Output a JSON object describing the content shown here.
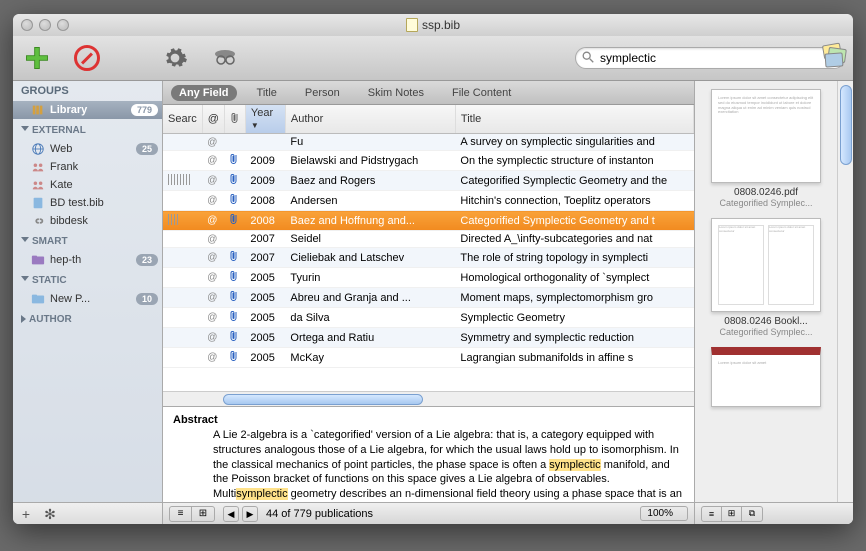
{
  "window": {
    "title": "ssp.bib"
  },
  "search": {
    "query": "symplectic"
  },
  "scopes": [
    "Any Field",
    "Title",
    "Person",
    "Skim Notes",
    "File Content"
  ],
  "active_scope": 0,
  "sidebar": {
    "groups_label": "GROUPS",
    "library": {
      "label": "Library",
      "count": "779"
    },
    "external_label": "EXTERNAL",
    "external": [
      {
        "label": "Web",
        "count": "25"
      },
      {
        "label": "Frank",
        "count": ""
      },
      {
        "label": "Kate",
        "count": ""
      },
      {
        "label": "BD test.bib",
        "count": ""
      },
      {
        "label": "bibdesk",
        "count": ""
      }
    ],
    "smart_label": "SMART",
    "smart": [
      {
        "label": "hep-th",
        "count": "23"
      }
    ],
    "static_label": "STATIC",
    "static": [
      {
        "label": "New P...",
        "count": "10"
      }
    ],
    "author_label": "AUTHOR"
  },
  "columns": {
    "search": "Searc",
    "at": "@",
    "clip": "",
    "year": "Year",
    "author": "Author",
    "title": "Title"
  },
  "rows": [
    {
      "year": "",
      "author": "Fu",
      "title": "A survey on symplectic singularities and",
      "clip": false,
      "stripe": "none"
    },
    {
      "year": "2009",
      "author": "Bielawski and Pidstrygach",
      "title": "On the symplectic structure of instanton",
      "clip": true,
      "stripe": "none"
    },
    {
      "year": "2009",
      "author": "Baez and Rogers",
      "title": "Categorified Symplectic Geometry and the",
      "clip": true,
      "stripe": "full"
    },
    {
      "year": "2008",
      "author": "Andersen",
      "title": "Hitchin's connection, Toeplitz operators",
      "clip": true,
      "stripe": "none"
    },
    {
      "year": "2008",
      "author": "Baez and Hoffnung and...",
      "title": "Categorified Symplectic Geometry and t",
      "clip": true,
      "stripe": "half",
      "selected": true
    },
    {
      "year": "2007",
      "author": "Seidel",
      "title": "Directed A_\\infty-subcategories and nat",
      "clip": false,
      "stripe": "none"
    },
    {
      "year": "2007",
      "author": "Cieliebak and Latschev",
      "title": "The role of string topology in symplecti",
      "clip": true,
      "stripe": "none"
    },
    {
      "year": "2005",
      "author": "Tyurin",
      "title": "Homological orthogonality of `symplect",
      "clip": true,
      "stripe": "none"
    },
    {
      "year": "2005",
      "author": "Abreu and Granja and ...",
      "title": "Moment maps, symplectomorphism gro",
      "clip": true,
      "stripe": "none"
    },
    {
      "year": "2005",
      "author": "da Silva",
      "title": "Symplectic Geometry",
      "clip": true,
      "stripe": "none"
    },
    {
      "year": "2005",
      "author": "Ortega and Ratiu",
      "title": "Symmetry and symplectic reduction",
      "clip": true,
      "stripe": "none"
    },
    {
      "year": "2005",
      "author": "McKay",
      "title": "Lagrangian submanifolds in affine s",
      "clip": true,
      "stripe": "none"
    }
  ],
  "abstract": {
    "heading": "Abstract",
    "pre": "A Lie 2-algebra is a `categorified' version of a Lie algebra: that is, a category equipped with structures analogous those of a Lie algebra, for which the usual laws hold up to isomorphism. In the classical mechanics of point particles, the phase space is often a ",
    "h1": "symplectic",
    "mid": " manifold, and the Poisson bracket of functions on this space gives a Lie algebra of observables. Multi",
    "h2": "symplectic",
    "post": " geometry describes an n-dimensional field theory using a phase space that is an `n-plectic manifold': a finite-dimensional manifold equipped with a"
  },
  "status": {
    "text": "44 of 779 publications",
    "zoom": "100%"
  },
  "previews": [
    {
      "title": "0808.0246.pdf",
      "sub": "Categorified Symplec..."
    },
    {
      "title": "0808.0246 Bookl...",
      "sub": "Categorified Symplec..."
    },
    {
      "title": "",
      "sub": ""
    }
  ]
}
